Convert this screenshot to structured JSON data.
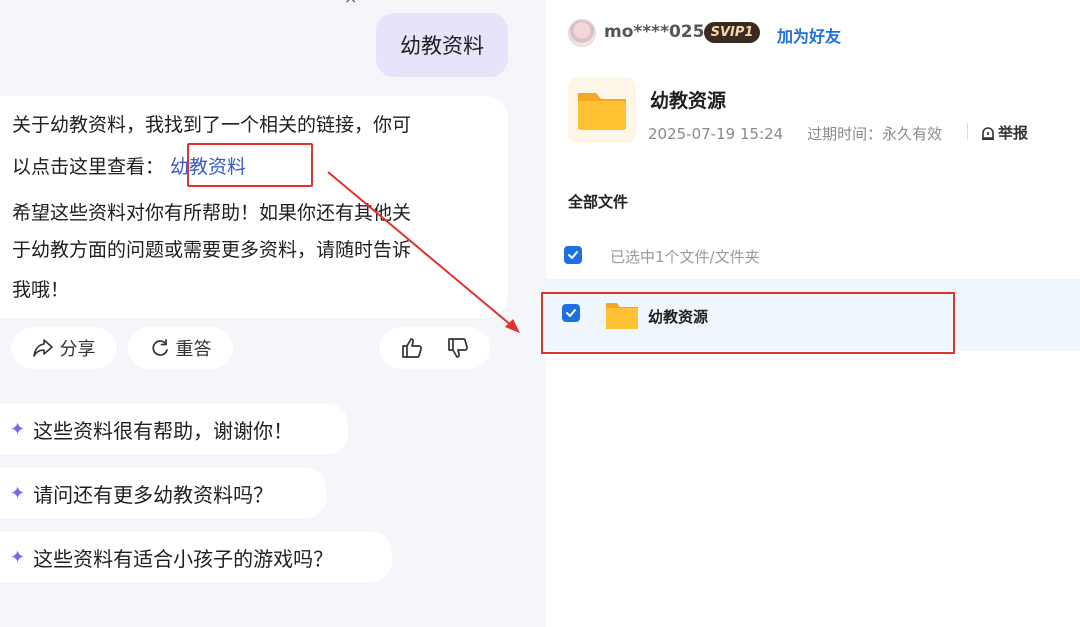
{
  "chat": {
    "top_glyph": "×",
    "user_message": "幼教资料",
    "answer": {
      "line1": "关于幼教资料，我找到了一个相关的链接，你可",
      "line2_prefix": "以点击这里查看：",
      "link_text": "幼教资料",
      "line3": "希望这些资料对你有所帮助！如果你还有其他关",
      "line4": "于幼教方面的问题或需要更多资料，请随时告诉",
      "line5": "我哦！"
    },
    "actions": {
      "share_label": "分享",
      "regenerate_label": "重答"
    },
    "suggestions": [
      "这些资料很有帮助，谢谢你！",
      "请问还有更多幼教资料吗？",
      "这些资料有适合小孩子的游戏吗？"
    ],
    "suggestion_icon": "sparkle-icon"
  },
  "share_panel": {
    "username": "mo****025",
    "vip_badge": "SVIP1",
    "add_friend_label": "加为好友",
    "folder_title": "幼教资源",
    "date": "2025-07-19 15:24",
    "expire_text": "过期时间：永久有效",
    "report_label": "举报",
    "all_files_label": "全部文件",
    "selected_text": "已选中1个文件/文件夹",
    "file_name": "幼教资源"
  },
  "colors": {
    "accent_blue": "#1e6fe0",
    "link_blue": "#3a59c7",
    "highlight_red": "#e0332b",
    "folder_yellow": "#ffc233",
    "bubble_purple": "#e6e3fb"
  }
}
